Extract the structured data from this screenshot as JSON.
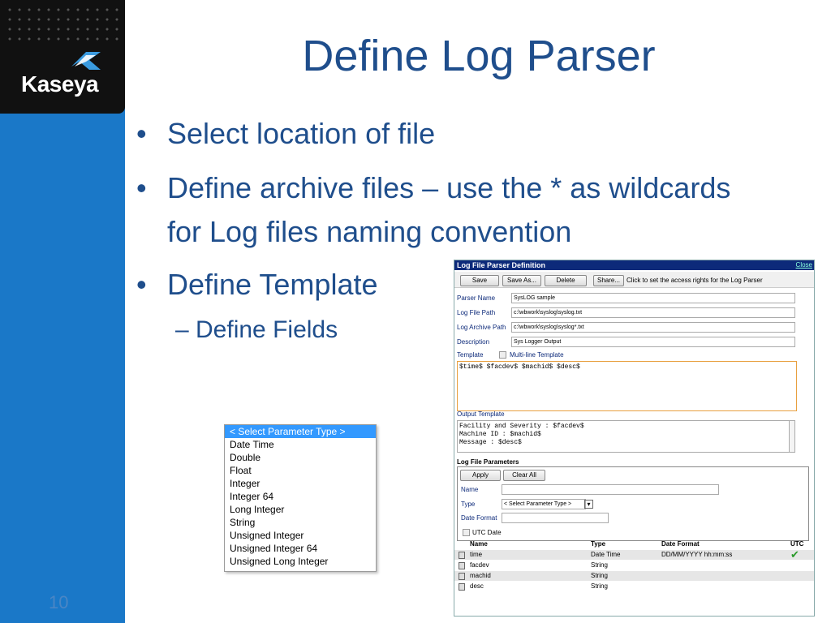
{
  "brand": {
    "name": "Kaseya"
  },
  "slide": {
    "title": "Define Log Parser",
    "bullets": [
      "Select location of file",
      "Define archive files – use the * as wildcards",
      "for Log files naming convention",
      "Define Template"
    ],
    "sub_bullet": "– Define Fields",
    "bullet_glyph": "•",
    "page_number": "10"
  },
  "param_list": {
    "options": [
      "< Select Parameter Type >",
      "Date Time",
      "Double",
      "Float",
      "Integer",
      "Integer 64",
      "Long Integer",
      "String",
      "Unsigned Integer",
      "Unsigned Integer 64",
      "Unsigned Long Integer"
    ],
    "selected_index": 0
  },
  "parser_window": {
    "title": "Log File Parser Definition",
    "close_label": "Close",
    "toolbar": {
      "save": "Save",
      "save_as": "Save As...",
      "delete": "Delete",
      "share": "Share...",
      "hint": "Click to set the access rights for the Log Parser"
    },
    "fields": {
      "parser_name_label": "Parser Name",
      "parser_name_value": "SysLOG sample",
      "log_path_label": "Log File Path",
      "log_path_value": "c:\\wbwork\\syslog\\syslog.txt",
      "archive_label": "Log Archive Path",
      "archive_value": "c:\\wbwork\\syslog\\syslog*.txt",
      "description_label": "Description",
      "description_value": "Sys Logger Output",
      "template_label": "Template",
      "multiline_label": "Multi-line Template",
      "template_value": "$time$  $facdev$        $machid$        $desc$",
      "output_label": "Output Template",
      "output_line1": "Facility and Severity : $facdev$",
      "output_line2": "Machine ID : $machid$",
      "output_line3": "Message : $desc$"
    },
    "parameters": {
      "heading": "Log File Parameters",
      "apply": "Apply",
      "clear_all": "Clear All",
      "name_label": "Name",
      "type_label": "Type",
      "type_value": "< Select Parameter Type >",
      "date_format_label": "Date Format",
      "utc_label": "UTC Date"
    },
    "grid": {
      "columns": [
        "Name",
        "Type",
        "Date Format",
        "UTC"
      ],
      "rows": [
        {
          "name": "time",
          "type": "Date Time",
          "date_format": "DD/MM/YYYY hh:mm:ss",
          "utc": "✔"
        },
        {
          "name": "facdev",
          "type": "String",
          "date_format": "",
          "utc": ""
        },
        {
          "name": "machid",
          "type": "String",
          "date_format": "",
          "utc": ""
        },
        {
          "name": "desc",
          "type": "String",
          "date_format": "",
          "utc": ""
        }
      ]
    }
  },
  "colors": {
    "accent": "#1f4e8c",
    "sidebar": "#1a78c8",
    "selection": "#3399ff",
    "check": "#2a9a2a"
  }
}
